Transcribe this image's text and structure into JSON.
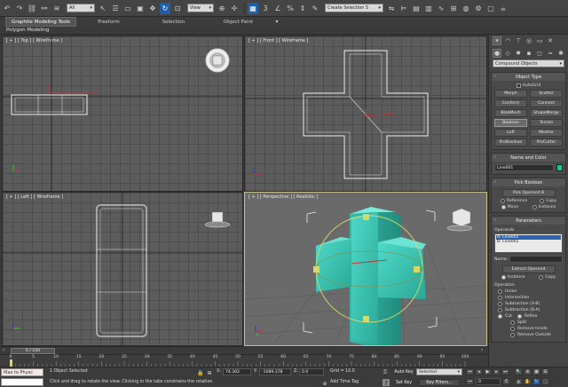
{
  "toolbar": {
    "filter_select": "All",
    "view_select": "View",
    "selection_set_placeholder": "Create Selection S"
  },
  "ribbon": {
    "tabs": [
      {
        "label": "Graphite Modeling Tools",
        "active": true
      },
      {
        "label": "Freeform",
        "active": false
      },
      {
        "label": "Selection",
        "active": false
      },
      {
        "label": "Object Paint",
        "active": false
      }
    ],
    "dropdown_glyph": "▾",
    "subpanel_label": "Polygon Modeling"
  },
  "viewports": {
    "top": {
      "label": "[ + ] [ Top ] [ Wireframe ]"
    },
    "front": {
      "label": "[ + ] [ Front ] [ Wireframe ]"
    },
    "left": {
      "label": "[ + ] [ Left ] [ Wireframe ]"
    },
    "perspective": {
      "label": "[ + ] [ Perspective ] [ Realistic ]"
    }
  },
  "command_panel": {
    "category_dropdown": "Compound Objects",
    "object_type": {
      "title": "Object Type",
      "autogrid_label": "AutoGrid",
      "buttons": [
        "Morph",
        "Scatter",
        "Conform",
        "Connect",
        "BlobMesh",
        "ShapeMerge",
        "Boolean",
        "Terrain",
        "Loft",
        "Mesher",
        "ProBoolean",
        "ProCutter"
      ]
    },
    "name_and_color": {
      "title": "Name and Color",
      "name_value": "Line001"
    },
    "pick_boolean": {
      "title": "Pick Boolean",
      "pick_button": "Pick Operand B",
      "radios": [
        {
          "label": "Reference",
          "checked": false
        },
        {
          "label": "Copy",
          "checked": false
        },
        {
          "label": "Move",
          "checked": true
        },
        {
          "label": "Instance",
          "checked": false
        }
      ]
    },
    "parameters": {
      "title": "Parameters",
      "operands_label": "Operands",
      "operands": [
        "A: Line001",
        "B: Line002"
      ],
      "name_label": "Name:",
      "name_value": "",
      "extract_button": "Extract Operand",
      "extract_radios": [
        {
          "label": "Instance",
          "checked": true
        },
        {
          "label": "Copy",
          "checked": false
        }
      ],
      "operation_label": "Operation",
      "operations": [
        {
          "label": "Union",
          "checked": false
        },
        {
          "label": "Intersection",
          "checked": false
        },
        {
          "label": "Subtraction (A-B)",
          "checked": false
        },
        {
          "label": "Subtraction (B-A)",
          "checked": false
        },
        {
          "label": "Cut",
          "checked": true
        }
      ],
      "cut_options": [
        {
          "label": "Refine",
          "checked": true
        },
        {
          "label": "Split",
          "checked": false
        },
        {
          "label": "Remove Inside",
          "checked": false
        },
        {
          "label": "Remove Outside",
          "checked": false
        }
      ]
    }
  },
  "timeline": {
    "position_text": "0 / 100",
    "ticks": [
      "0",
      "5",
      "10",
      "15",
      "20",
      "25",
      "30",
      "35",
      "40",
      "45",
      "50",
      "55",
      "60",
      "65",
      "70",
      "75",
      "80",
      "85",
      "90",
      "95",
      "100"
    ]
  },
  "status": {
    "maxscript_text": "Max to Physc",
    "selection_info": "1 Object Selected",
    "prompt": "Click and drag to rotate the view.  Clicking in the tabs constrains the rotation",
    "x_label": "X:",
    "x_value": "74.302",
    "y_label": "Y:",
    "y_value": "-1089.378",
    "z_label": "Z:",
    "z_value": "0.0",
    "grid_text": "Grid = 10.0",
    "add_time_tag": "Add Time Tag",
    "auto_key": "Auto Key",
    "set_key": "Set Key",
    "key_selection": "Selected",
    "key_filters": "Key Filters...",
    "frame_value": "0"
  }
}
